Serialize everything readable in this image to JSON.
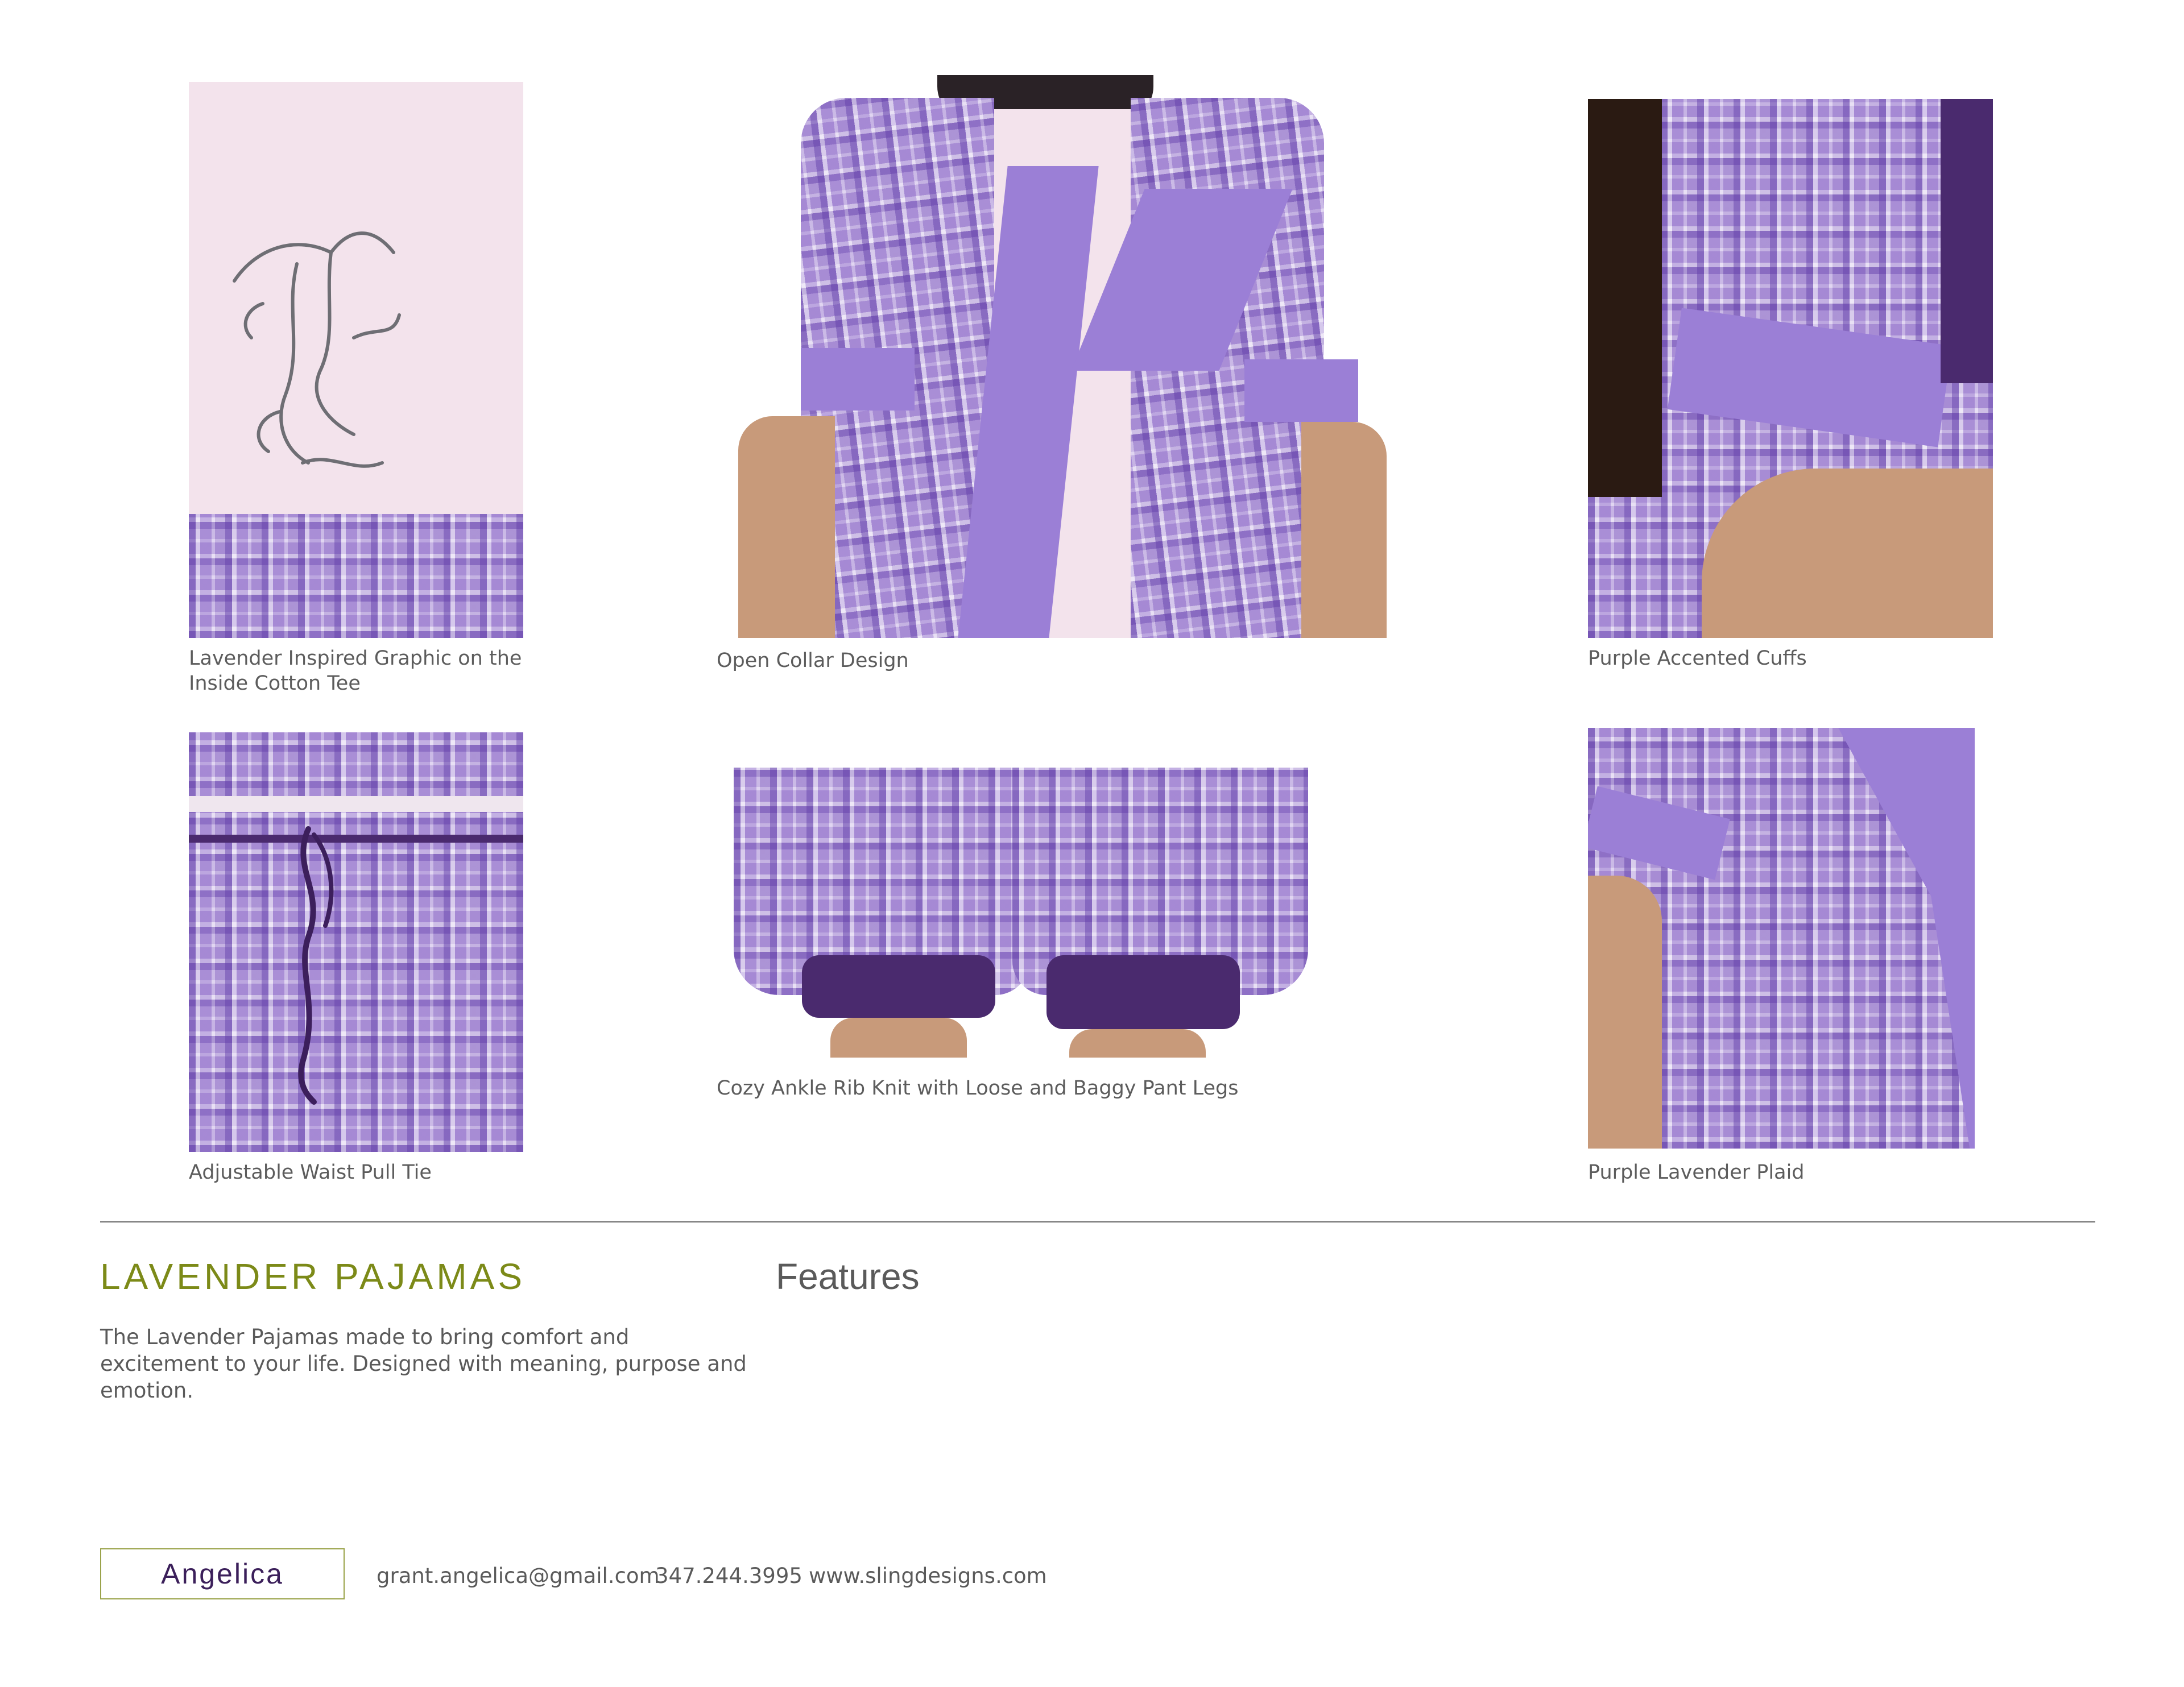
{
  "gallery": {
    "items": [
      {
        "caption": "Lavender Inspired Graphic on the\nInside Cotton Tee",
        "icon": "tee-graphic-photo"
      },
      {
        "caption": "Open Collar Design",
        "icon": "open-collar-photo"
      },
      {
        "caption": "Purple Accented Cuffs",
        "icon": "cuff-photo"
      },
      {
        "caption": "Adjustable Waist Pull Tie",
        "icon": "waist-tie-photo"
      },
      {
        "caption": "Cozy Ankle Rib Knit with Loose and Baggy Pant Legs",
        "icon": "ankle-knit-photo"
      },
      {
        "caption": "Purple Lavender Plaid",
        "icon": "plaid-photo"
      }
    ]
  },
  "product": {
    "title": "LAVENDER PAJAMAS",
    "section_heading": "Features",
    "description": "The Lavender Pajamas made to bring comfort and excitement to your life.  Designed with meaning, purpose and emotion."
  },
  "footer": {
    "logo": "Angelica",
    "email": "grant.angelica@gmail.com",
    "phone": "347.244.3995",
    "website": "www.slingdesigns.com"
  },
  "colors": {
    "title_green": "#7c8a18",
    "logo_purple": "#3b1f5a",
    "lavender": "#9b7fd6"
  }
}
